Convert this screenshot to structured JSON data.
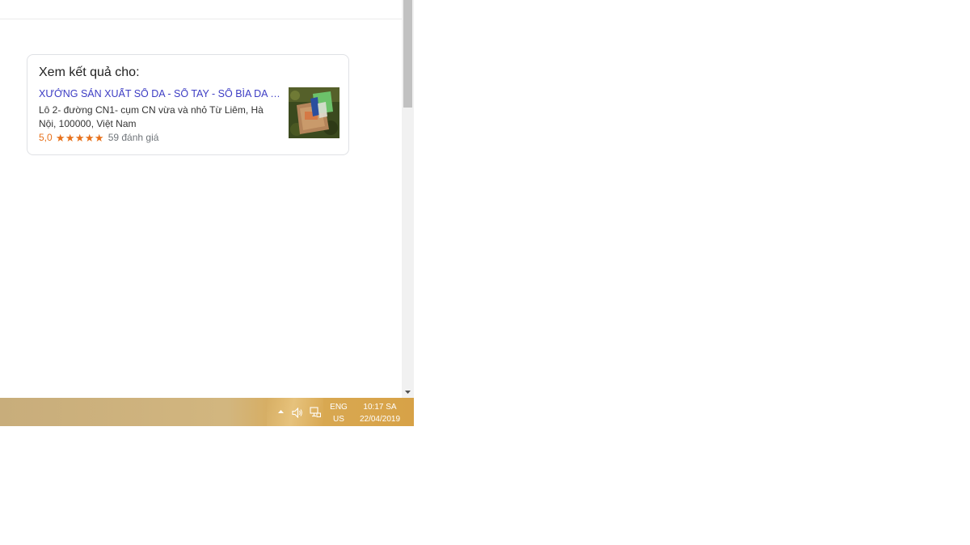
{
  "card": {
    "heading": "Xem kết quả cho:",
    "place_name": "XƯỞNG SẢN XUẤT SỔ DA - SỔ TAY - SỔ BÌA DA NHẬT BẢN",
    "address": "Lô 2- đường CN1- cụm CN vừa và nhỏ Từ Liêm, Hà Nội, 100000, Việt Nam",
    "rating": "5,0",
    "star_count": 5,
    "reviews": "59 đánh giá",
    "link_color": "#3c3cc4",
    "star_color": "#e7711b"
  },
  "taskbar": {
    "language_line1": "ENG",
    "language_line2": "US",
    "time": "10:17 SA",
    "date": "22/04/2019",
    "icons": [
      "chevron-up-icon",
      "speaker-icon",
      "network-icon"
    ]
  }
}
